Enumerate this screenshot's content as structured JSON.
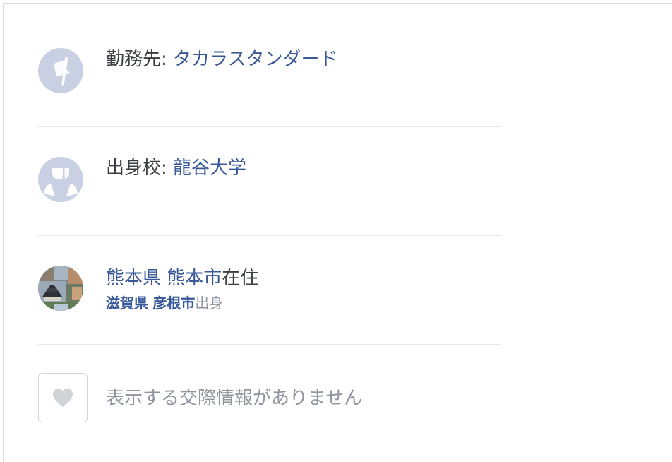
{
  "work": {
    "label": "勤務先: ",
    "company": "タカラスタンダード",
    "icon": "flag-icon"
  },
  "education": {
    "label": "出身校: ",
    "school": "龍谷大学",
    "icon": "graduation-cap-icon"
  },
  "places": {
    "current_prefecture": "熊本県",
    "current_city": "熊本市",
    "current_suffix": "在住",
    "home_prefecture": "滋賀県",
    "home_city": "彦根市",
    "home_suffix": "出身",
    "icon": "kumamoto-castle-photo"
  },
  "relationship": {
    "text": "表示する交際情報がありません",
    "icon": "heart-icon"
  },
  "colors": {
    "link": "#385898",
    "text": "#3b3d42",
    "muted": "#90949c",
    "icon_bg": "#c9d0e4"
  }
}
